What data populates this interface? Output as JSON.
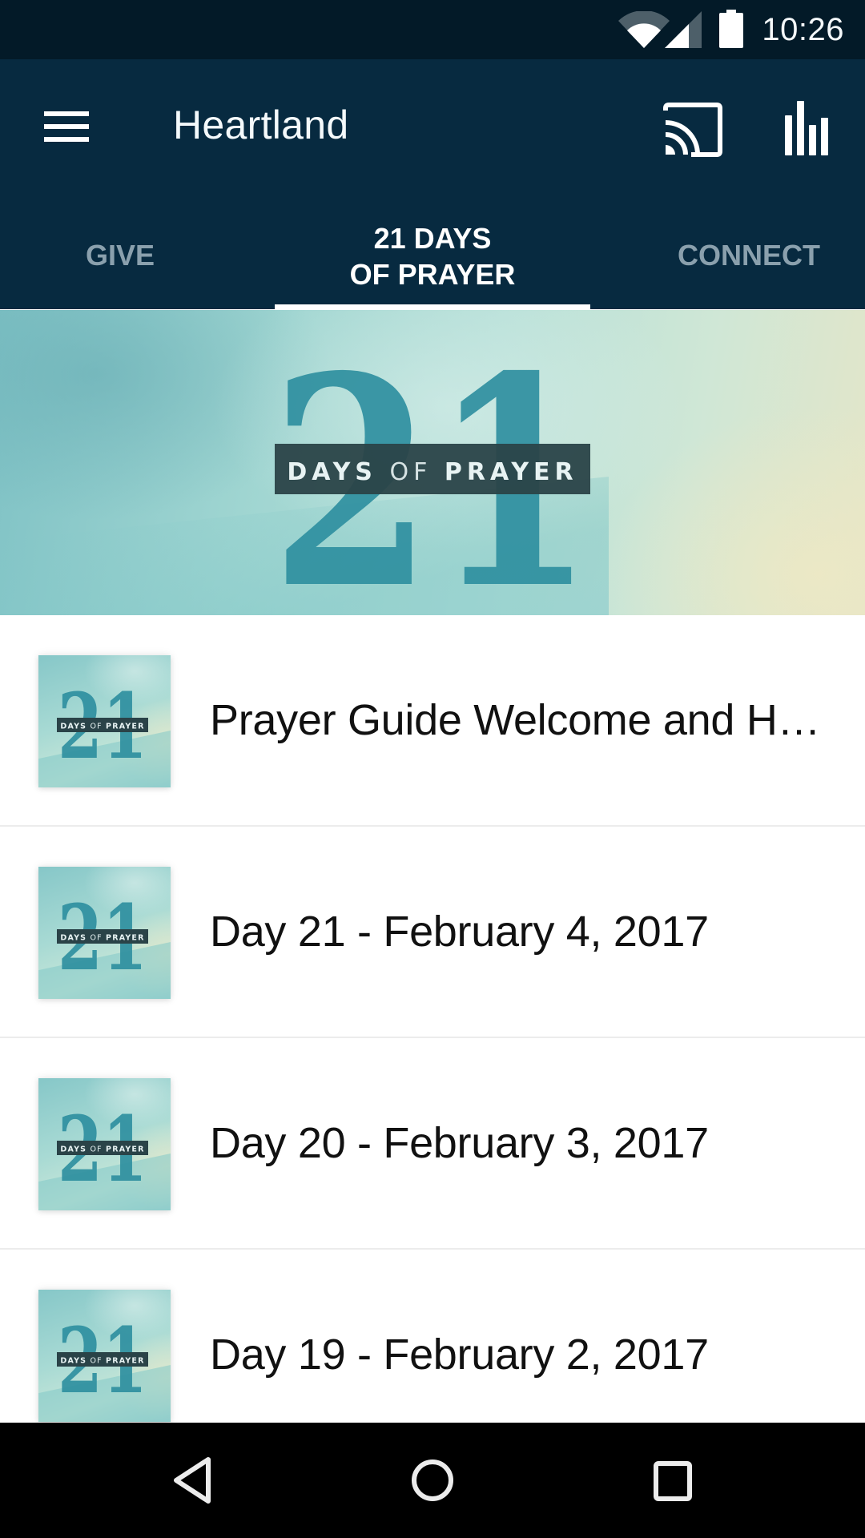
{
  "status_bar": {
    "time": "10:26",
    "icons": [
      "wifi-icon",
      "cell-signal-icon",
      "battery-icon"
    ]
  },
  "app_bar": {
    "title": "Heartland",
    "menu_icon": "hamburger-menu-icon",
    "actions": [
      {
        "name": "cast",
        "icon": "cast-icon"
      },
      {
        "name": "stats",
        "icon": "bar-chart-icon"
      }
    ]
  },
  "tabs": [
    {
      "label": "GIVE",
      "active": false
    },
    {
      "label_line1": "21 DAYS",
      "label_line2": "OF PRAYER",
      "active": true
    },
    {
      "label": "CONNECT",
      "active": false
    }
  ],
  "banner": {
    "number": "21",
    "word1": "DAYS",
    "word2": "OF",
    "word3": "PRAYER"
  },
  "thumbnail": {
    "number": "21",
    "caption_bold_1": "DAYS",
    "caption_light": "OF",
    "caption_bold_2": "PRAYER"
  },
  "list": {
    "items": [
      {
        "title": "Prayer Guide Welcome and How to Use"
      },
      {
        "title": "Day 21 - February 4, 2017"
      },
      {
        "title": "Day 20 - February 3, 2017"
      },
      {
        "title": "Day 19 - February 2, 2017"
      }
    ]
  },
  "nav_bar": {
    "buttons": [
      "back-icon",
      "home-icon",
      "recents-icon"
    ]
  },
  "colors": {
    "status_bar_bg": "#031a28",
    "app_bar_bg": "#072a40",
    "tab_inactive": "#8aa0ad",
    "tab_active": "#ffffff",
    "art_teal": "#2f8fa0",
    "art_label_box": "#2a4348"
  }
}
